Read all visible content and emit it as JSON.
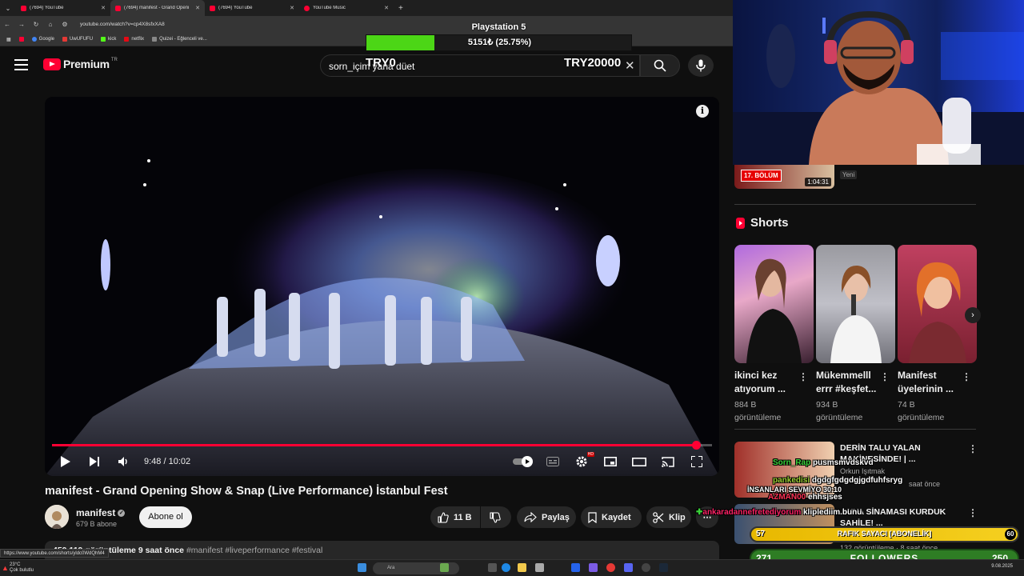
{
  "browser": {
    "tabs": [
      {
        "title": "(7694) YouTube",
        "active": false
      },
      {
        "title": "(7694) manifest - Grand Openi",
        "active": true
      },
      {
        "title": "(7694) YouTube",
        "active": false
      },
      {
        "title": "YouTube Music",
        "active": false
      }
    ],
    "url": "youtube.com/watch?v=cp4X8sfxXA8",
    "bookmarks": [
      "Google",
      "UwUFUFU",
      "kick",
      "netflix",
      "Quizei - Eğlenceli ve..."
    ]
  },
  "overlay": {
    "goal_title": "Playstation 5",
    "goal_text": "5151₺ (25.75%)",
    "goal_progress": 0.2575,
    "try_left": "TRY0",
    "try_right": "TRY20000"
  },
  "youtube": {
    "logo_text": "Premium",
    "logo_region": "TR",
    "search_value": "sorn_içim yana düet",
    "player": {
      "time": "9:48 / 10:02",
      "progress": 0.976,
      "hd_badge": "HD"
    },
    "video_title": "manifest - Grand Opening Show & Snap (Live Performance) İstanbul Fest",
    "channel_name": "manifest",
    "subscribers": "679 B abone",
    "subscribe_label": "Abone ol",
    "likes": "11 B",
    "share_label": "Paylaş",
    "save_label": "Kaydet",
    "clip_label": "Klip",
    "description": {
      "views": "459.119 görüntüleme",
      "age": "9 saat önce",
      "tags": "#manifest #liveperformance #festival"
    }
  },
  "sidebar": {
    "top_video": {
      "badge": "17. BÖLÜM",
      "duration": "1:04:31",
      "tag": "Yeni"
    },
    "shorts_header": "Shorts",
    "shorts": [
      {
        "title": "ikinci kez atıyorum ...",
        "views": "884 B",
        "views_suffix": "görüntüleme"
      },
      {
        "title": "Mükemmelll errr #keşfet...",
        "views": "934 B",
        "views_suffix": "görüntüleme"
      },
      {
        "title": "Manifest üyelerinin ...",
        "views": "74 B",
        "views_suffix": "görüntüleme"
      }
    ],
    "recs": [
      {
        "title": "DERİN TALU YALAN MAKİNESİNDE! | ...",
        "channel": "Orkun Işıtmak",
        "meta": "saat önce"
      },
      {
        "title": "...NYA SİNAMASI KURDUK SAHİLE! ...",
        "channel": "",
        "meta": "132 görüntüleme · 8 saat önce"
      }
    ]
  },
  "chat_overlay": [
    {
      "user": "Sorn_Rap",
      "msg": "pusmsmvdskvd",
      "color": "#3ad13a"
    },
    {
      "user": "pankedisi",
      "msg": "dgdgfgdgdgjgdfuhfsryg",
      "color": "#9acd32"
    },
    {
      "user": "İNSANLARI SEVMİYO 30:10",
      "msg": "",
      "color": "#ffffff"
    },
    {
      "user": "AZMAN00",
      "msg": "ehhsjses",
      "color": "#ff3355"
    },
    {
      "user": "ankaradannefretediyorum",
      "msg": "kliplediim bunu",
      "color": "#ff2266"
    }
  ],
  "stream_widgets": {
    "rafik_count": "57",
    "rafik_label": "RAFIK SAYACI [ABONELİK]",
    "rafik_end": "60",
    "followers_current": "271",
    "followers_label": "FOLLOWERS",
    "followers_goal": "250"
  },
  "status_url": "https://www.youtube.com/shorts/yldc0WdQhM4",
  "taskbar": {
    "weather_temp": "23°C",
    "weather_desc": "Çok bulutlu",
    "search_placeholder": "Ara",
    "date": "9.08.2025"
  }
}
